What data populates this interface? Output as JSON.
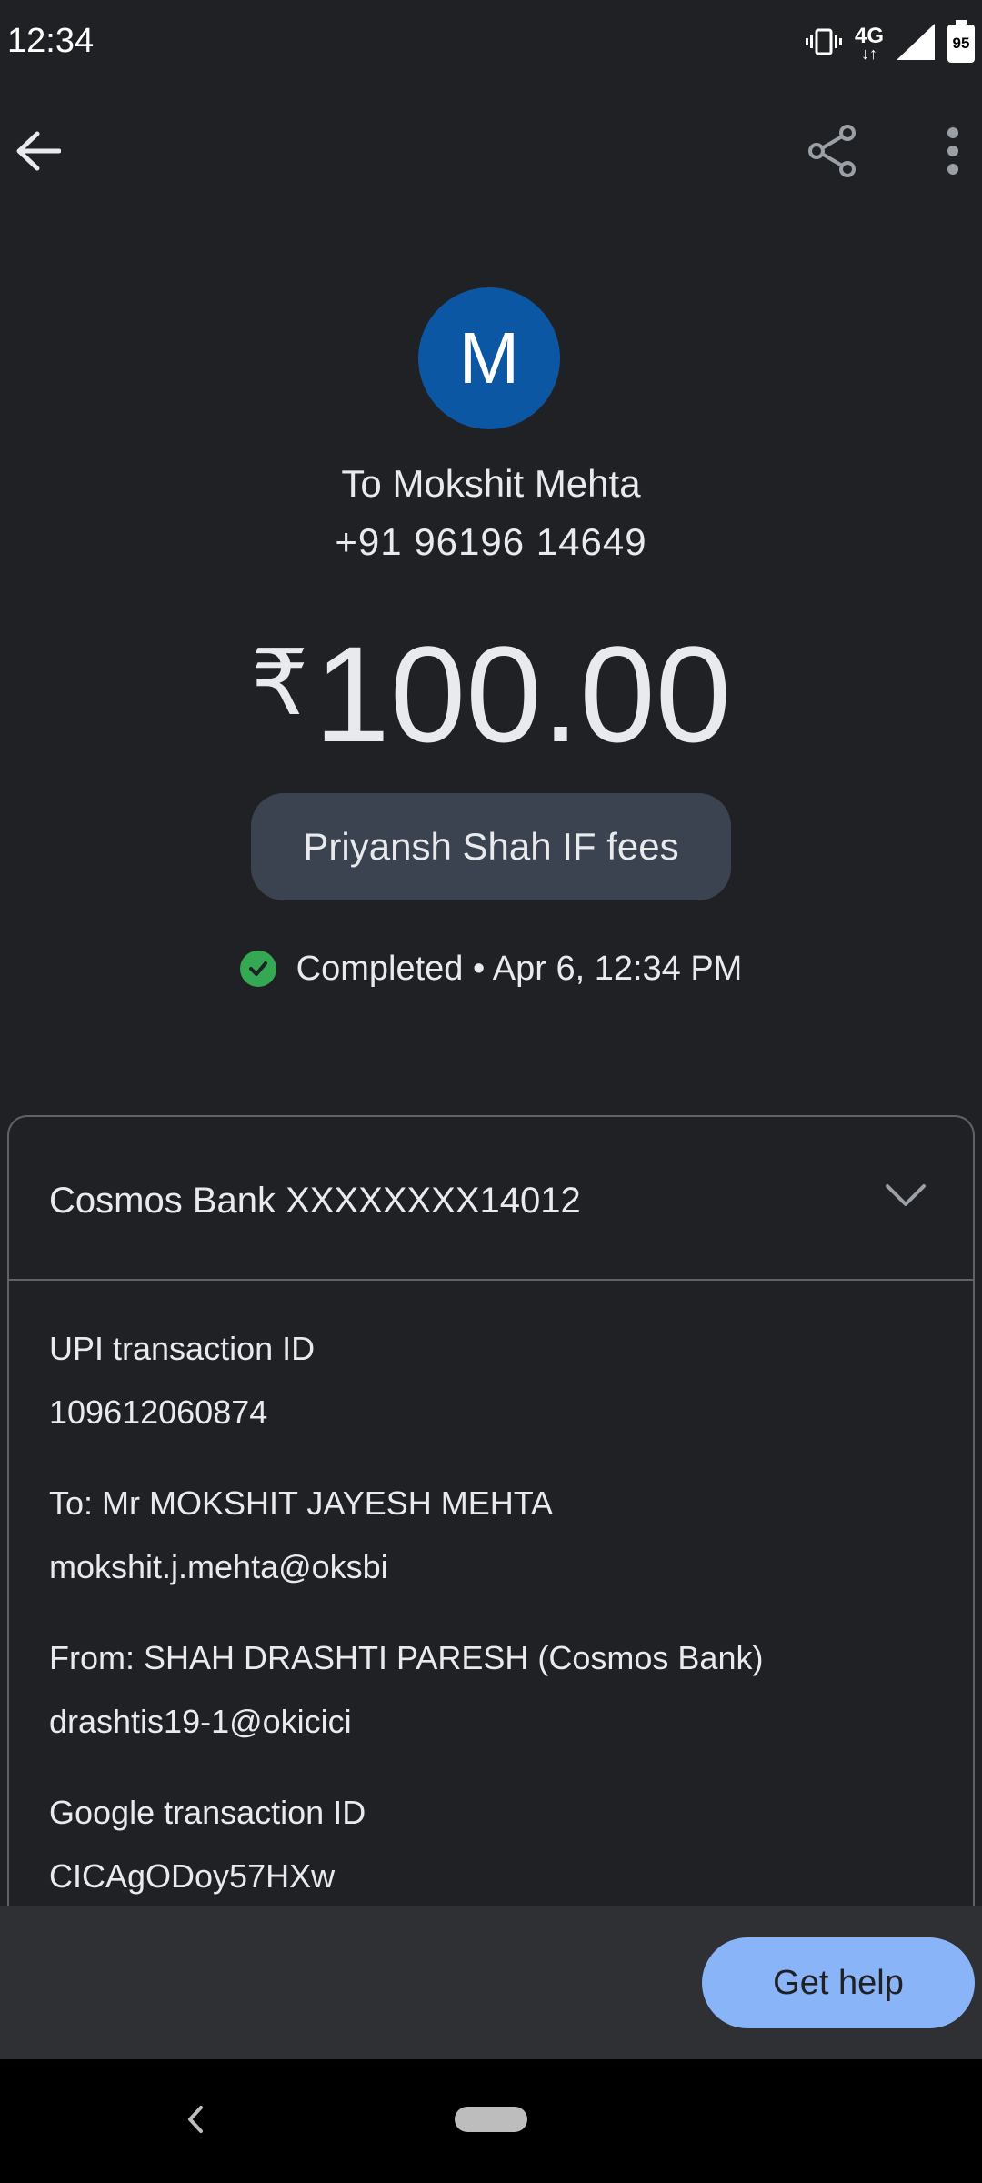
{
  "status_bar": {
    "time": "12:34",
    "network": "4G",
    "battery": "95",
    "icons": [
      "vibrate-icon",
      "network-4g-icon",
      "signal-icon",
      "battery-icon"
    ]
  },
  "app_bar": {
    "icons": [
      "back-arrow-icon",
      "share-icon",
      "more-vert-icon"
    ]
  },
  "payee": {
    "avatar_initial": "M",
    "avatar_color": "#0b57a4",
    "name_line": "To Mokshit Mehta",
    "phone": "+91 96196 14649"
  },
  "payment": {
    "currency_symbol": "₹",
    "amount": "100.00",
    "note": "Priyansh Shah IF fees",
    "status": "Completed",
    "separator": "•",
    "datetime": "Apr 6, 12:34 PM",
    "status_color": "#34a853"
  },
  "details": {
    "bank_account": "Cosmos Bank XXXXXXXX14012",
    "upi_id_label": "UPI transaction ID",
    "upi_id_value": "109612060874",
    "to_label": "To: Mr MOKSHIT JAYESH MEHTA",
    "to_vpa": "mokshit.j.mehta@oksbi",
    "from_label": "From: SHAH DRASHTI PARESH (Cosmos Bank)",
    "from_vpa": "drashtis19-1@okicici",
    "google_id_label": "Google transaction ID",
    "google_id_value": "CICAgODoy57HXw"
  },
  "actions": {
    "help_label": "Get help",
    "help_color": "#8ab4f8"
  }
}
